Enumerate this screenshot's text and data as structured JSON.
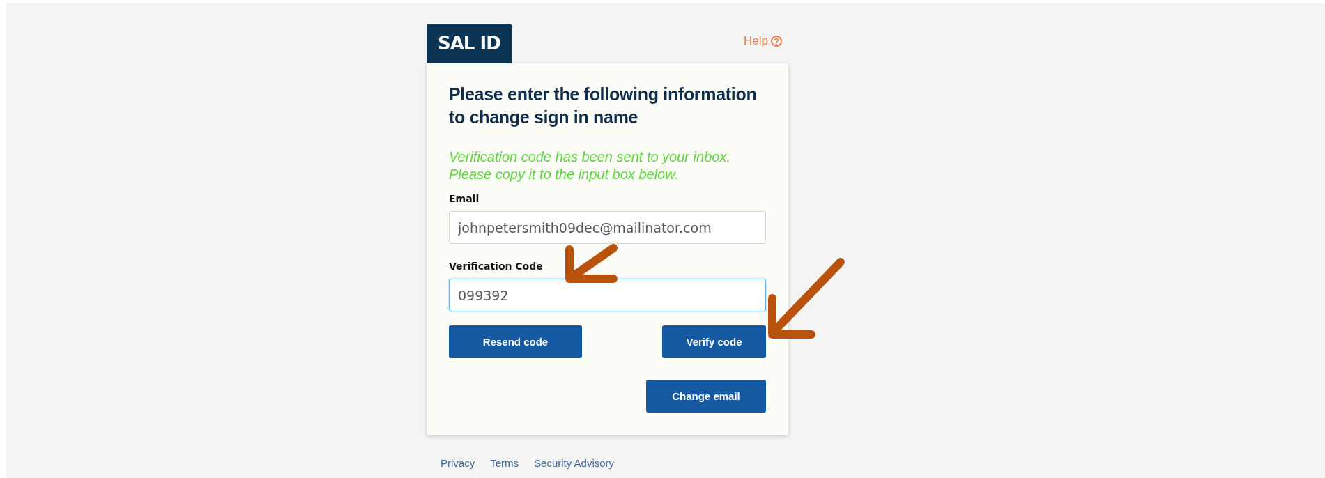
{
  "brand": {
    "logo": "SAL ID"
  },
  "help": {
    "label": "Help",
    "icon": "?"
  },
  "form": {
    "heading": "Please enter the following information to change sign in name",
    "message": [
      "Verification code has been sent to your inbox.",
      "Please copy it to the input box below."
    ],
    "fields": [
      {
        "label": "Email",
        "value": "johnpetersmith09dec@mailinator.com",
        "focused": false
      },
      {
        "label": "Verification Code",
        "value": "099392",
        "focused": true
      }
    ],
    "buttons": [
      {
        "label": "Resend code",
        "kind": "resend"
      },
      {
        "label": "Verify code",
        "kind": "verify"
      },
      {
        "label": "Change email",
        "kind": "change"
      }
    ]
  },
  "footer": {
    "links": [
      "Privacy",
      "Terms",
      "Security Advisory"
    ]
  }
}
